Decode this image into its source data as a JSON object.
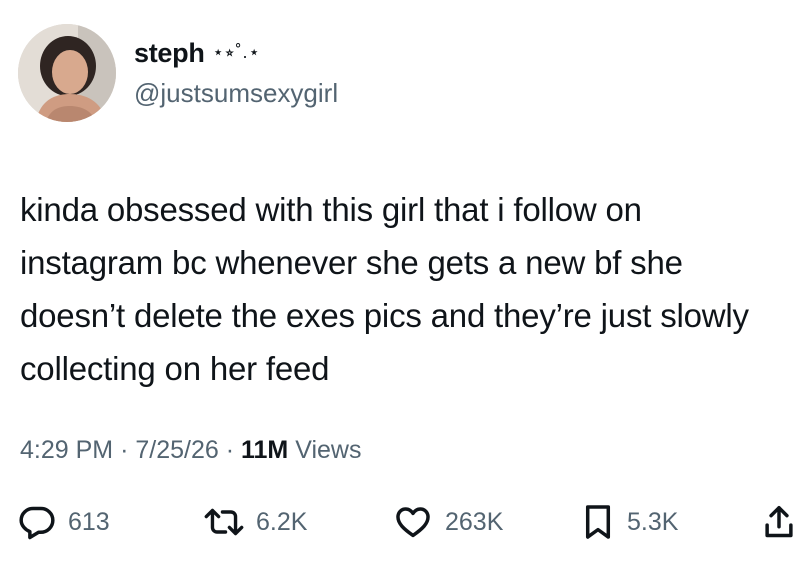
{
  "author": {
    "display_name": "steph",
    "name_decoration": "⋆⭒˚.⋆",
    "handle": "@justsumsexygirl"
  },
  "tweet": {
    "text": "kinda obsessed with this girl that i follow on instagram bc whenever she gets a new bf she doesn’t delete the exes pics and they’re just slowly collecting on her feed"
  },
  "meta": {
    "time": "4:29 PM",
    "separator": "·",
    "date": "7/25/26",
    "views_count": "11M",
    "views_label": "Views"
  },
  "actions": {
    "replies": "613",
    "reposts": "6.2K",
    "likes": "263K",
    "bookmarks": "5.3K"
  },
  "icons": {
    "reply": "reply-icon",
    "repost": "repost-icon",
    "like": "heart-icon",
    "bookmark": "bookmark-icon",
    "share": "share-icon"
  },
  "colors": {
    "text": "#0f1419",
    "secondary": "#536471"
  }
}
